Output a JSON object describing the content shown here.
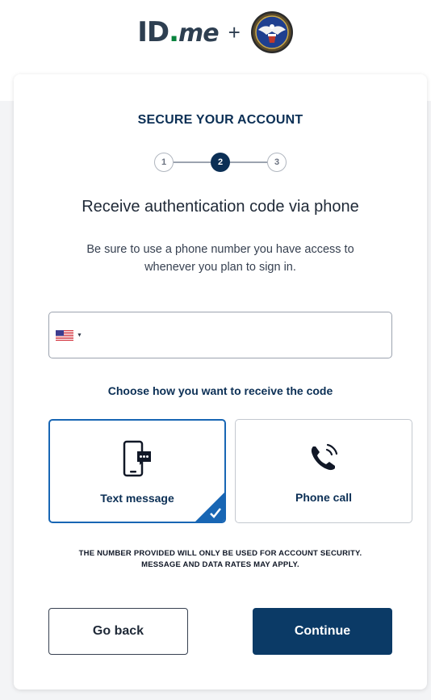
{
  "header": {
    "logo_id": "ID",
    "logo_dot": ".",
    "logo_me": "me",
    "plus": "+"
  },
  "card": {
    "title": "SECURE YOUR ACCOUNT",
    "steps": [
      {
        "label": "1",
        "state": "inactive"
      },
      {
        "label": "2",
        "state": "active"
      },
      {
        "label": "3",
        "state": "inactive"
      }
    ],
    "heading": "Receive authentication code via phone",
    "subtext": "Be sure to use a phone number you have access to whenever you plan to sign in.",
    "phone": {
      "country": "US",
      "value": "",
      "placeholder": ""
    },
    "choose_label": "Choose how you want to receive the code",
    "options": [
      {
        "label": "Text message",
        "icon": "phone-message-icon",
        "selected": true
      },
      {
        "label": "Phone call",
        "icon": "phone-call-icon",
        "selected": false
      }
    ],
    "disclaimer": "THE NUMBER PROVIDED WILL ONLY BE USED FOR ACCOUNT SECURITY. MESSAGE AND DATA RATES MAY APPLY.",
    "buttons": {
      "back": "Go back",
      "continue": "Continue"
    }
  },
  "colors": {
    "navy": "#0b2f55",
    "selected_border": "#1866b4",
    "continue_bg": "#0b3a66",
    "idme_green": "#08833d"
  }
}
